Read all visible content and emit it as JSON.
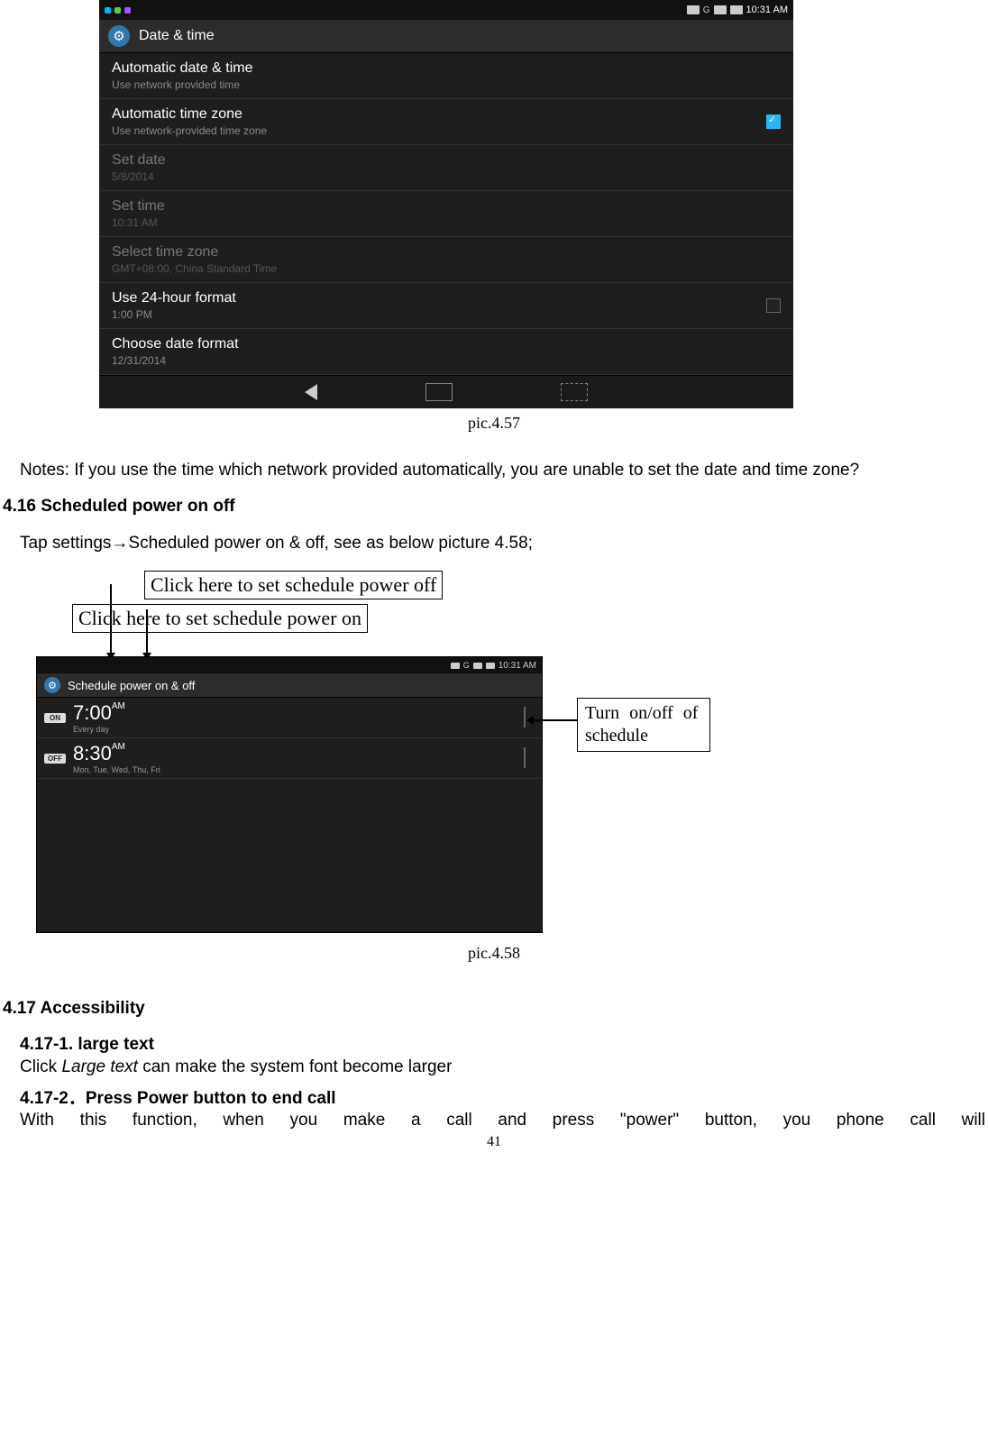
{
  "screenshot1": {
    "status_time": "10:31 AM",
    "signal_label": "G",
    "title": "Date & time",
    "rows": [
      {
        "label": "Automatic date & time",
        "sub": "Use network provided time",
        "checked": false,
        "enabled": true,
        "has_checkbox": false
      },
      {
        "label": "Automatic time zone",
        "sub": "Use network-provided time zone",
        "checked": true,
        "enabled": true,
        "has_checkbox": true
      },
      {
        "label": "Set date",
        "sub": "5/8/2014",
        "enabled": false
      },
      {
        "label": "Set time",
        "sub": "10:31 AM",
        "enabled": false
      },
      {
        "label": "Select time zone",
        "sub": "GMT+08:00, China Standard Time",
        "enabled": false
      },
      {
        "label": "Use 24-hour format",
        "sub": "1:00 PM",
        "checked": false,
        "enabled": true,
        "has_checkbox": true
      },
      {
        "label": "Choose date format",
        "sub": "12/31/2014",
        "enabled": true
      }
    ]
  },
  "caption1": "pic.4.57",
  "notes": "Notes: If you use the time which network provided automatically, you are unable to set the date and time zone?",
  "heading_416": "4.16 Scheduled power on off",
  "para_416": "Tap settings→Scheduled power on & off, see as below picture 4.58;",
  "annot_off": "Click here to set schedule power off",
  "annot_on": "Click here to set schedule power on",
  "annot_side": "Turn on/off of schedule",
  "screenshot2": {
    "status_time": "10:31 AM",
    "signal_label": "G",
    "title": "Schedule power on & off",
    "rows": [
      {
        "badge": "ON",
        "time": "7:00",
        "ampm": "AM",
        "sub": "Every day"
      },
      {
        "badge": "OFF",
        "time": "8:30",
        "ampm": "AM",
        "sub": "Mon, Tue, Wed, Thu, Fri"
      }
    ]
  },
  "caption2": "pic.4.58",
  "heading_417": "4.17 Accessibility",
  "heading_4171": "4.17-1. large text",
  "para_4171a": "Click ",
  "para_4171_italic": "Large text",
  "para_4171b": " can make the system font become larger",
  "heading_4172": "4.17-2．Press Power button to end call",
  "para_4172": "With this function, when you make a call and press \"power\" button, you phone call will",
  "page_number": "41"
}
